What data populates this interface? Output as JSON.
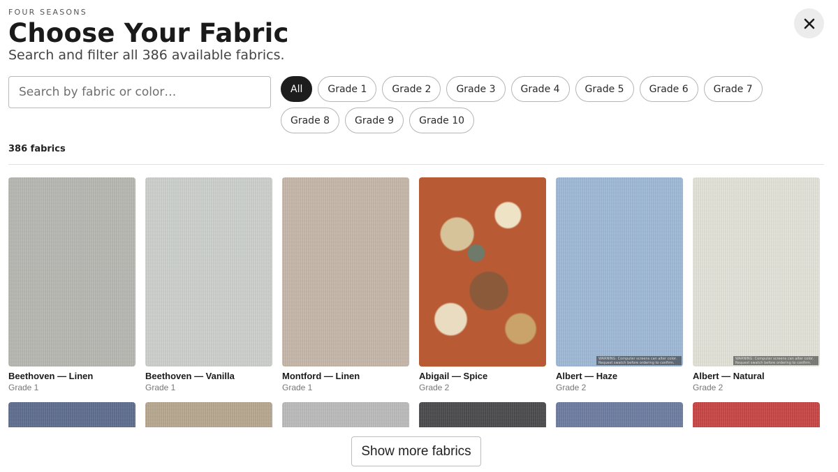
{
  "header": {
    "brand": "FOUR SEASONS",
    "title": "Choose Your Fabric",
    "subtitle": "Search and filter all 386 available fabrics."
  },
  "search": {
    "placeholder": "Search by fabric or color…",
    "value": ""
  },
  "filters": {
    "selected": "All",
    "chips": [
      "All",
      "Grade 1",
      "Grade 2",
      "Grade 3",
      "Grade 4",
      "Grade 5",
      "Grade 6",
      "Grade 7",
      "Grade 8",
      "Grade 9",
      "Grade 10"
    ]
  },
  "results": {
    "count_label": "386 fabrics"
  },
  "fabrics": [
    {
      "name": "Beethoven — Linen",
      "grade": "Grade 1",
      "color": "#b9b9b3"
    },
    {
      "name": "Beethoven — Vanilla",
      "grade": "Grade 1",
      "color": "#cfd3cf"
    },
    {
      "name": "Montford — Linen",
      "grade": "Grade 1",
      "color": "#c9b8aa"
    },
    {
      "name": "Abigail — Spice",
      "grade": "Grade 2",
      "color": "#b85a33"
    },
    {
      "name": "Albert — Haze",
      "grade": "Grade 2",
      "color": "#9dbbdc",
      "warning": "WARNING: Computer screens can alter color. Request swatch before ordering to confirm."
    },
    {
      "name": "Albert — Natural",
      "grade": "Grade 2",
      "color": "#e7e7dd",
      "warning": "WARNING: Computer screens can alter color. Request swatch before ordering to confirm."
    }
  ],
  "next_row_colors": [
    "#5a6a8c",
    "#b8a890",
    "#bdbdbd",
    "#454548",
    "#6a7aa0",
    "#c8403e"
  ],
  "actions": {
    "show_more": "Show more fabrics"
  },
  "icons": {
    "close": "close-icon"
  }
}
